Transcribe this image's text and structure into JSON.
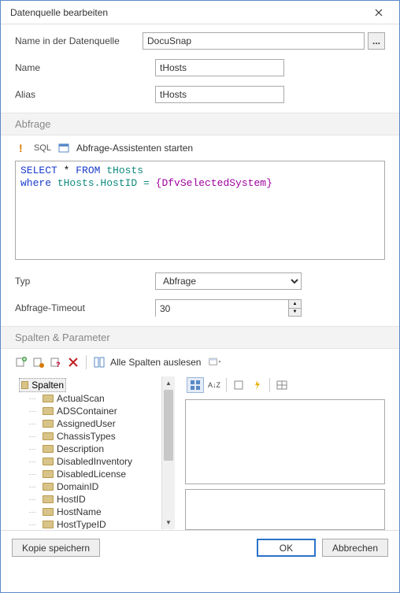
{
  "title": "Datenquelle bearbeiten",
  "labels": {
    "name_in_ds": "Name in der Datenquelle",
    "name": "Name",
    "alias": "Alias",
    "typ": "Typ",
    "timeout": "Abfrage-Timeout"
  },
  "values": {
    "name_in_ds": "DocuSnap",
    "name": "tHosts",
    "alias": "tHosts",
    "typ": "Abfrage",
    "timeout": "30"
  },
  "ellipsis": "...",
  "sections": {
    "abfrage": "Abfrage",
    "spalten_param": "Spalten & Parameter"
  },
  "toolbar": {
    "sql_label": "SQL",
    "wizard": "Abfrage-Assistenten starten"
  },
  "sql": {
    "line1_kw1": "SELECT",
    "line1_star": " * ",
    "line1_kw2": "FROM",
    "line1_tbl": " tHosts",
    "line2_kw1": "where",
    "line2_txt": " tHosts.HostID = ",
    "line2_param": "{DfvSelectedSystem}"
  },
  "cols_toolbar": {
    "read_all": "Alle Spalten auslesen"
  },
  "tree": {
    "root": "Spalten",
    "items": [
      "ActualScan",
      "ADSContainer",
      "AssignedUser",
      "ChassisTypes",
      "Description",
      "DisabledInventory",
      "DisabledLicense",
      "DomainID",
      "HostID",
      "HostName",
      "HostTypeID"
    ]
  },
  "prop_sort": "A↓Z",
  "footer": {
    "save_copy": "Kopie speichern",
    "ok": "OK",
    "cancel": "Abbrechen"
  }
}
